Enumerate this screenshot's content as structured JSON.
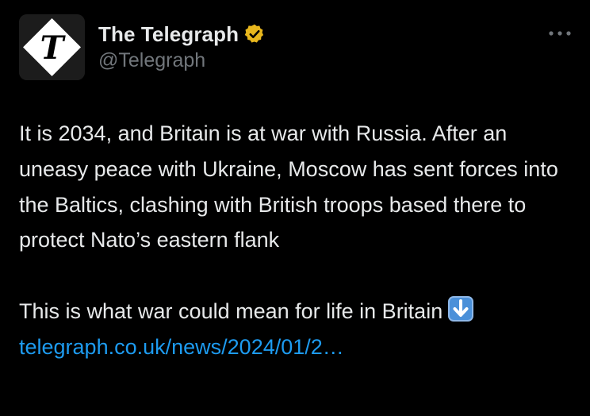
{
  "account": {
    "display_name": "The Telegraph",
    "handle": "@Telegraph",
    "verified_color": "#e8b71d",
    "avatar_icon": "telegraph-t-logo"
  },
  "menu": {
    "icon": "more-horizontal-icon"
  },
  "tweet": {
    "paragraph1": "It is 2034, and Britain is at war with Russia. After an uneasy peace with Ukraine, Moscow has sent forces into the Baltics, clashing with British troops based there to protect Nato’s eastern flank",
    "paragraph2": "This is what war could mean for life in Britain",
    "emoji_icon": "down-arrow-emoji",
    "link_text": "telegraph.co.uk/news/2024/01/2…",
    "link_color": "#1d9bf0"
  },
  "theme": {
    "background": "#000000",
    "text": "#e7e9ea",
    "muted": "#71767b"
  }
}
